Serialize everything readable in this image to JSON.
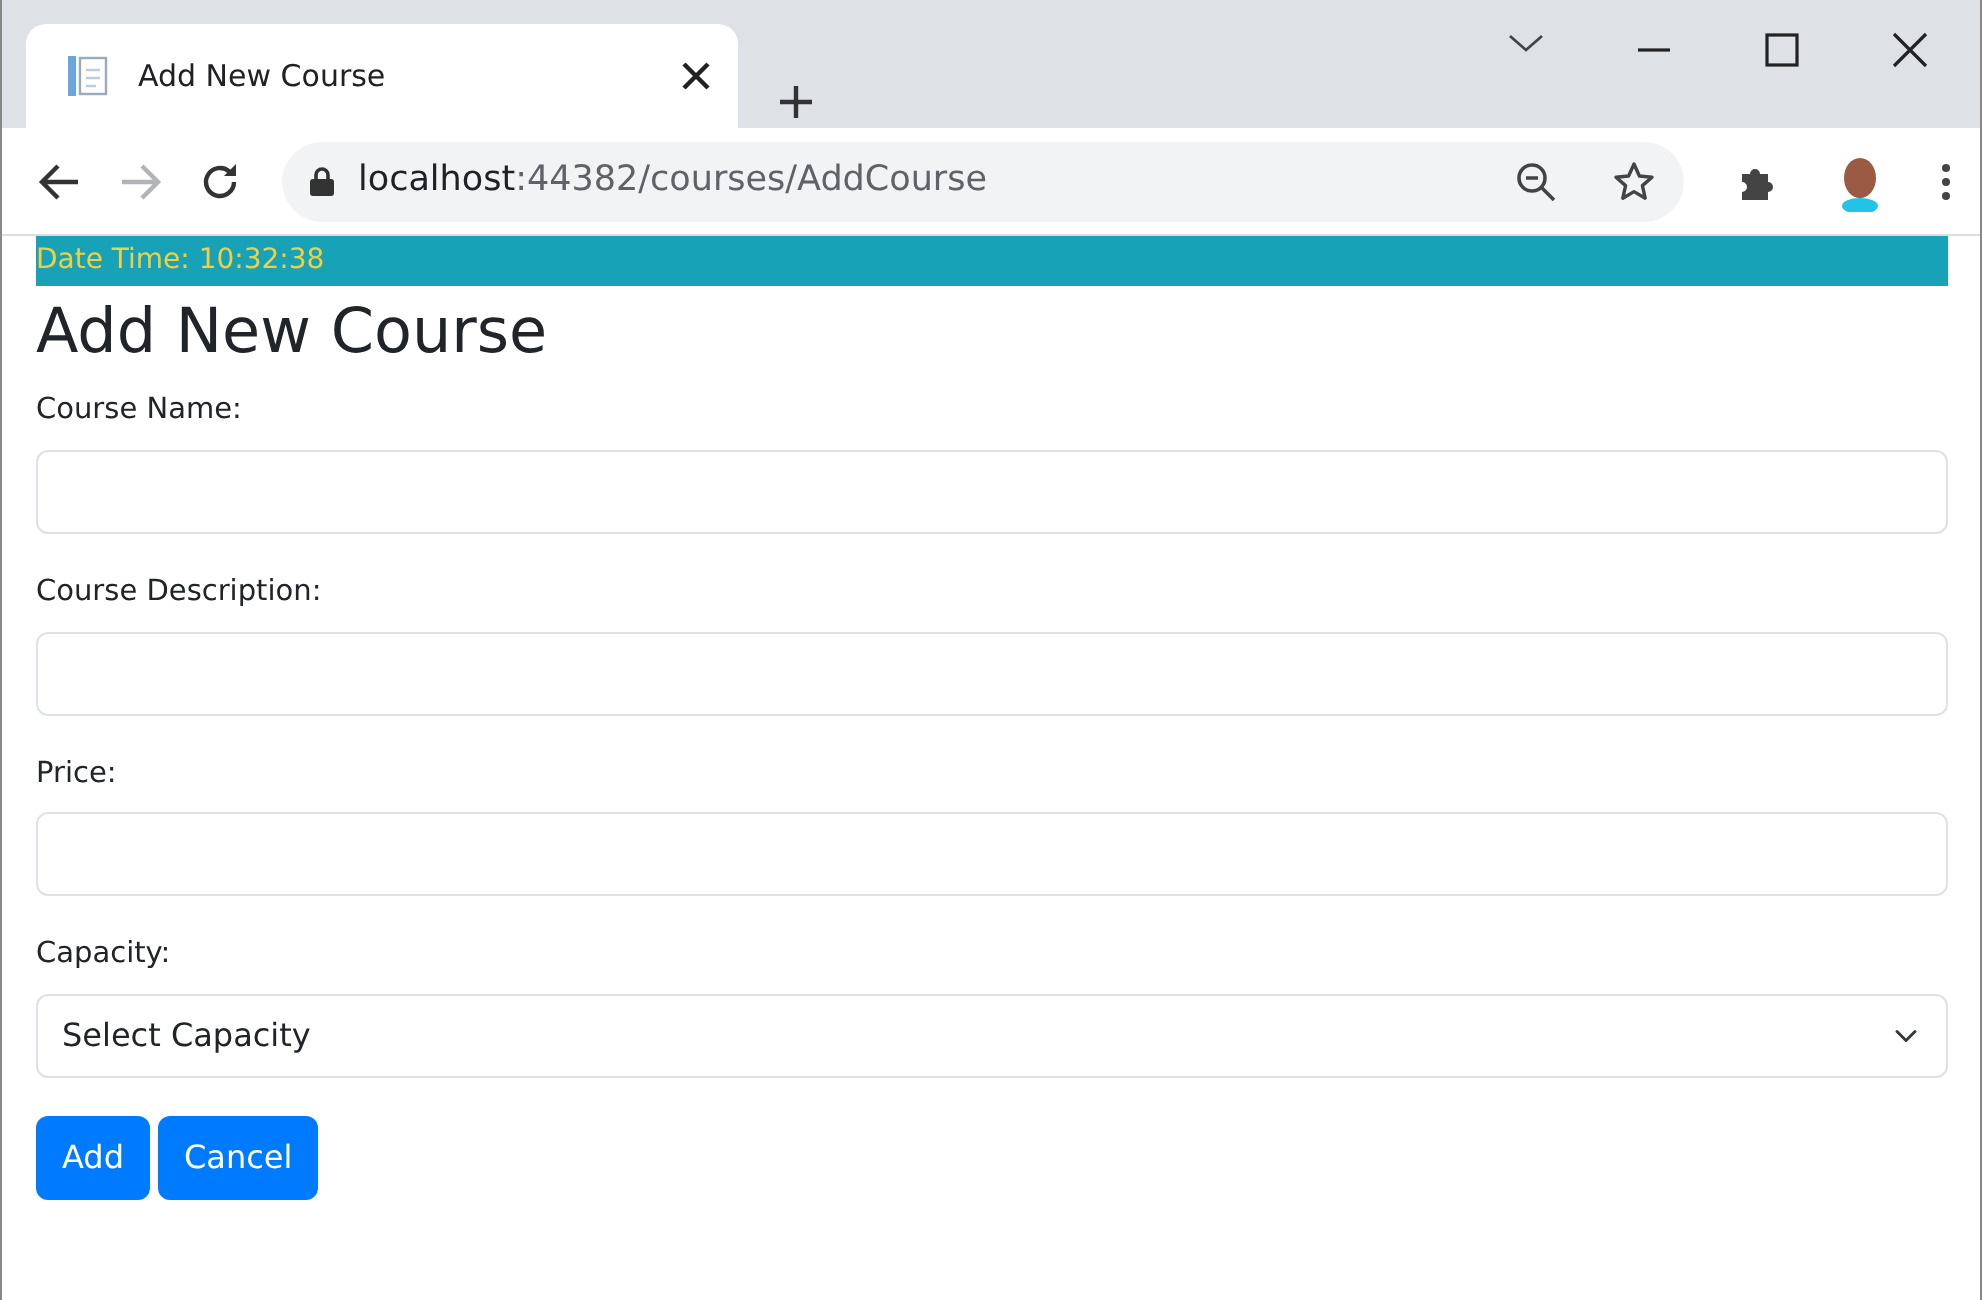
{
  "browser": {
    "tab": {
      "title": "Add New Course",
      "selected": true
    },
    "address": {
      "host": "localhost",
      "path": ":44382/courses/AddCourse"
    },
    "forward_disabled": true
  },
  "clock": "Date Time: 10:32:38",
  "heading": "Add New Course",
  "fields": [
    {
      "kind": "input",
      "label": "Course Name:"
    },
    {
      "kind": "input",
      "label": "Course Description:"
    },
    {
      "kind": "input",
      "label": "Price:"
    },
    {
      "kind": "select",
      "label": "Capacity:",
      "value": "Select Capacity"
    }
  ],
  "buttons": [
    "Add",
    "Cancel"
  ]
}
